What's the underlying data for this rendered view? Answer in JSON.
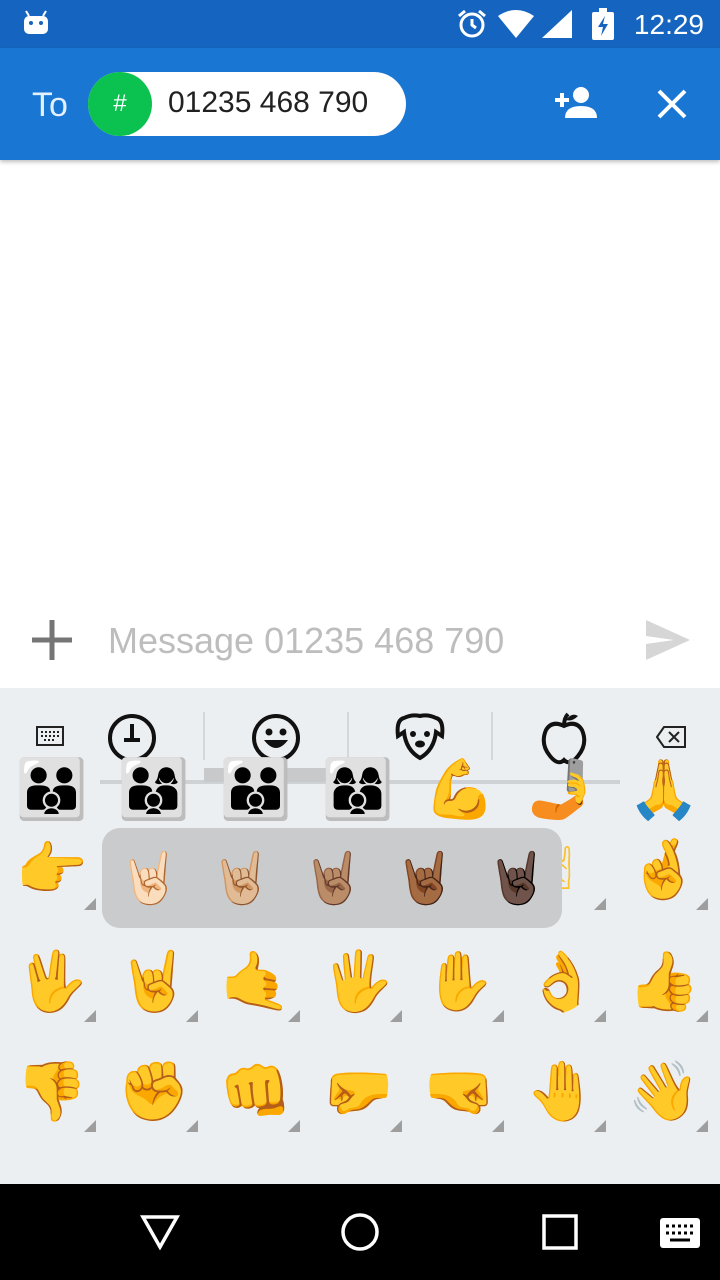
{
  "status_bar": {
    "time": "12:29",
    "icons": [
      "android-icon",
      "alarm-icon",
      "wifi-icon",
      "cell-signal-icon",
      "battery-charging-icon"
    ]
  },
  "toolbar": {
    "to_label": "To",
    "recipient": {
      "avatar_symbol": "#",
      "number": "01235 468 790"
    },
    "colors": {
      "bar": "#1976d2",
      "status": "#1565c0",
      "avatar": "#0bc14f"
    }
  },
  "compose": {
    "placeholder": "Message 01235 468 790"
  },
  "keyboard": {
    "tabs": [
      "keyboard-icon",
      "recent-icon",
      "smiley-icon",
      "animal-icon",
      "food-icon",
      "backspace-icon"
    ],
    "active_tab": "smiley-icon",
    "skin_tone_popup": [
      "🤘🏻",
      "🤘🏼",
      "🤘🏽",
      "🤘🏾",
      "🤘🏿"
    ],
    "rows": [
      [
        "👪",
        "👨‍👩‍👦",
        "👨‍👨‍👦",
        "👩‍👩‍👦",
        "💪",
        "🤳",
        "🙏"
      ],
      [
        "👉",
        "",
        "",
        "",
        "",
        "✌",
        "🤞"
      ],
      [
        "🖖",
        "🤘",
        "🤙",
        "🖐",
        "✋",
        "👌",
        "👍"
      ],
      [
        "👎",
        "✊",
        "👊",
        "🤛",
        "🤜",
        "🤚",
        "👋"
      ]
    ]
  }
}
